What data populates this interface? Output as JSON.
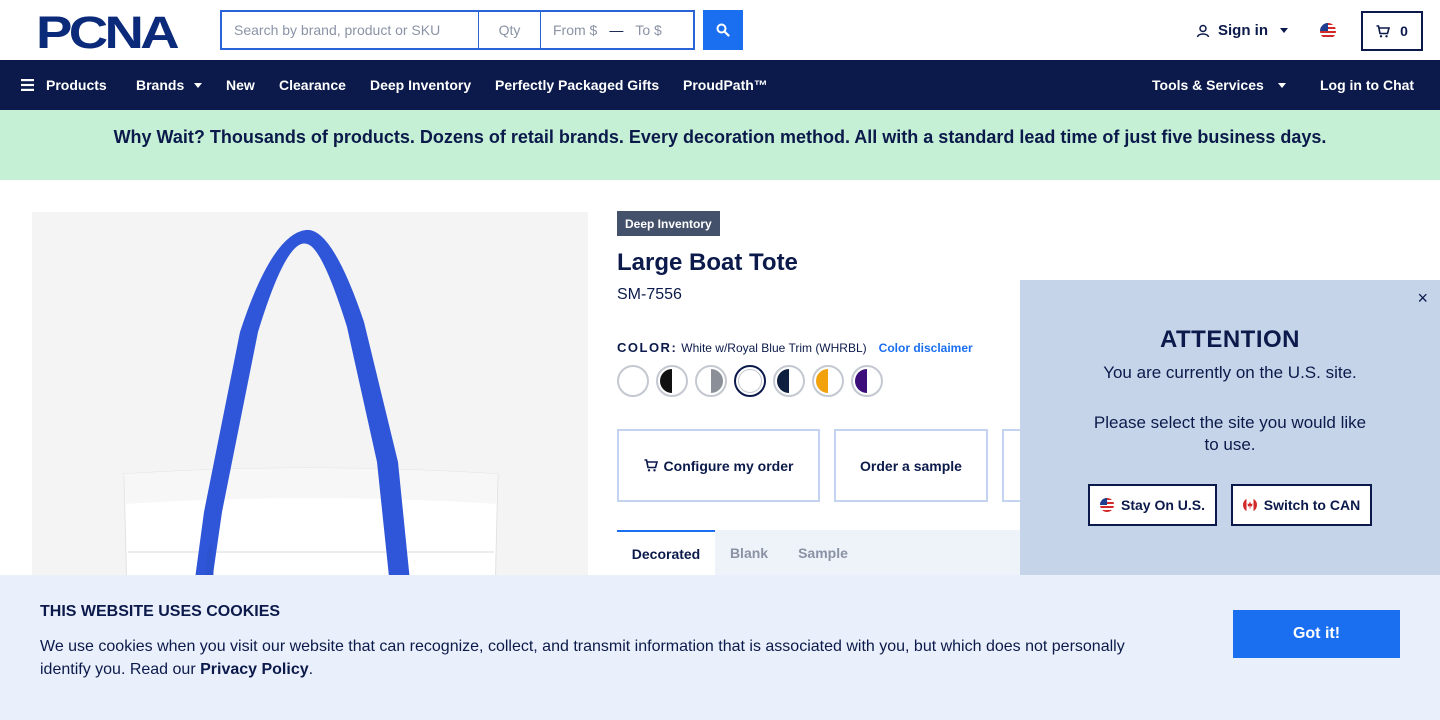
{
  "header": {
    "logo_text": "PCNA",
    "search": {
      "placeholder": "Search by brand, product or SKU",
      "qty_placeholder": "Qty",
      "from_placeholder": "From $",
      "range_separator": "—",
      "to_placeholder": "To $"
    },
    "sign_in_label": "Sign in",
    "cart_count": "0"
  },
  "nav": {
    "products": "Products",
    "brands": "Brands",
    "new": "New",
    "clearance": "Clearance",
    "deep_inventory": "Deep Inventory",
    "gifts": "Perfectly Packaged Gifts",
    "proudpath": "ProudPath™",
    "tools": "Tools & Services",
    "chat": "Log in to Chat"
  },
  "banner": {
    "text": "Why Wait? Thousands of products. Dozens of retail brands. Every decoration method. All with a standard lead time of just five business days."
  },
  "product": {
    "badge": "Deep Inventory",
    "title": "Large Boat Tote",
    "sku": "SM-7556",
    "color_label": "COLOR:",
    "color_value": "White w/Royal Blue Trim (WHRBL)",
    "color_disclaimer": "Color disclaimer",
    "swatches": [
      {
        "name": "White",
        "trim": "#ffffff"
      },
      {
        "name": "White w/Black Trim",
        "trim": "#111111"
      },
      {
        "name": "White w/Gray Trim",
        "trim": "#8a8f98"
      },
      {
        "name": "White w/Royal Blue Trim",
        "trim": "#ffffff",
        "selected": true
      },
      {
        "name": "White w/Navy Trim",
        "trim": "#0f1f3f"
      },
      {
        "name": "White w/Orange Trim",
        "trim": "#f2a20c"
      },
      {
        "name": "White w/Purple Trim",
        "trim": "#3b0e7a"
      }
    ],
    "configure_label": "Configure my order",
    "sample_label": "Order a sample",
    "tabs": [
      "Decorated",
      "Blank",
      "Sample"
    ]
  },
  "attention": {
    "title": "ATTENTION",
    "message1": "You are currently on the U.S. site.",
    "message2": "Please select the site you would like to use.",
    "stay_label": "Stay On U.S.",
    "switch_label": "Switch to CAN",
    "close_symbol": "×"
  },
  "cookie": {
    "title": "THIS WEBSITE USES COOKIES",
    "text": "We use cookies when you visit our website that can recognize, collect, and transmit information that is associated with you, but which does not personally identify you. Read our ",
    "link": "Privacy Policy",
    "end": ".",
    "button": "Got it!"
  },
  "colors": {
    "navy": "#0b1a4a",
    "accent": "#1a6ff0",
    "banner_bg": "#c5f0d6",
    "popup_bg": "#c6d4ea",
    "cookie_bg": "#eaf0fb",
    "tote_handle": "#2f56d9"
  }
}
